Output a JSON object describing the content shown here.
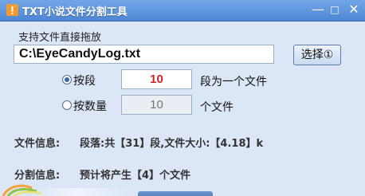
{
  "window": {
    "title": "TXT小说文件分割工具",
    "minimize_glyph": "—",
    "maximize_glyph": "□",
    "close_glyph": "✕",
    "icon": "orange-warning-icon"
  },
  "file": {
    "hint": "支持文件直接拖放",
    "path": "C:\\EyeCandyLog.txt",
    "select_button": "选择①"
  },
  "split": {
    "by_paragraph_label": "按段",
    "by_paragraph_value": "10",
    "by_paragraph_suffix": "段为一个文件",
    "by_count_label": "按数量",
    "by_count_value": "10",
    "by_count_suffix": "个文件",
    "selected": "by_paragraph"
  },
  "info": {
    "file_info_label": "文件信息:",
    "file_info_value": "段落:共【31】段,文件大小:【4.18】k",
    "split_info_label": "分割信息:",
    "split_info_value": "预计将产生【4】个文件"
  },
  "colors": {
    "titlebar": "#5a8fd8",
    "background": "#dbe7f7",
    "active_value": "#d21f1f"
  }
}
